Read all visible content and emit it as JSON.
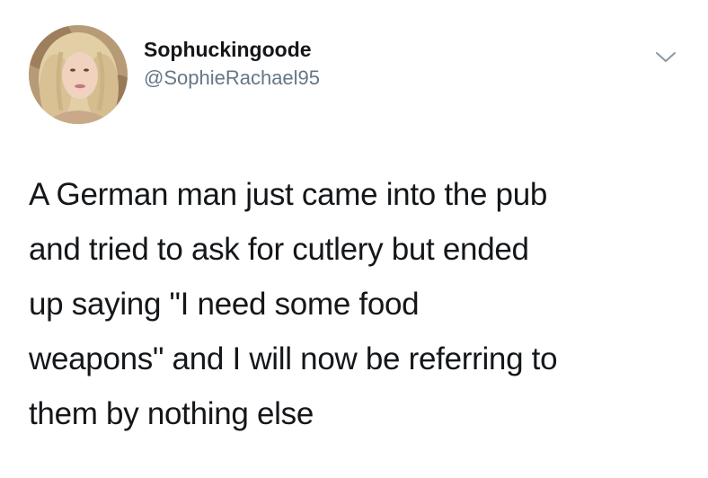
{
  "tweet": {
    "author": {
      "display_name": "Sophuckingoode",
      "handle": "@SophieRachael95",
      "avatar_icon": "profile-photo"
    },
    "menu_icon": "chevron-down-icon",
    "text_lines": [
      "A German man just came into the pub",
      "and tried to ask for cutlery but ended",
      "up saying \"I need some food",
      "weapons\" and I will now be referring to",
      "them by nothing else"
    ]
  },
  "colors": {
    "text": "#14171a",
    "secondary_text": "#657786",
    "background": "#ffffff"
  }
}
